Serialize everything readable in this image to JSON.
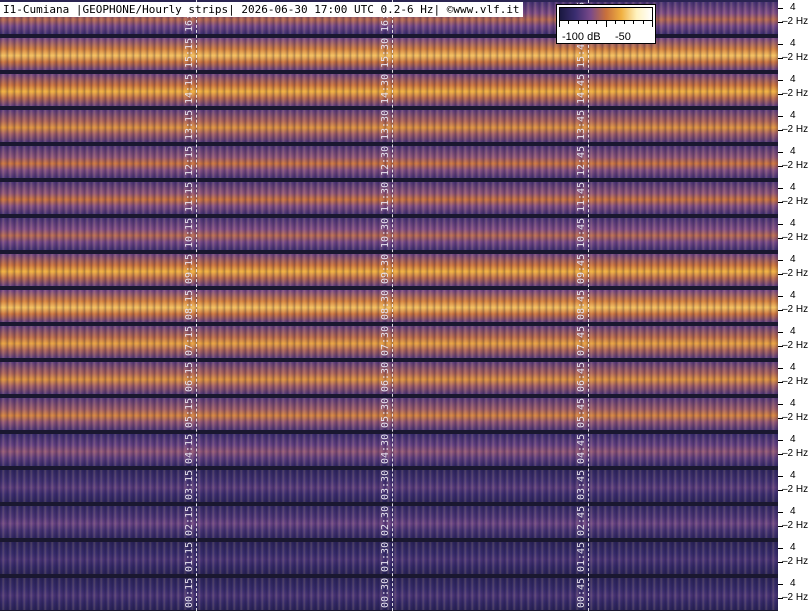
{
  "header": {
    "title": "I1-Cumiana |GEOPHONE/Hourly strips| 2026-06-30 17:00 UTC 0.2-6 Hz| ©www.vlf.it"
  },
  "colorbar": {
    "label_low": "-100 dB",
    "label_high": "-50",
    "colors": [
      "#1a1840",
      "#3a2d70",
      "#7a4a8a",
      "#c8703c",
      "#f0b040",
      "#fff3c0",
      "#ffffff"
    ]
  },
  "frequency_axis": {
    "upper_label": "4",
    "lower_label": "2 Hz"
  },
  "strips": [
    {
      "intensity": 0.55,
      "labels": [
        "16:15",
        "16:30",
        "16:45"
      ]
    },
    {
      "intensity": 0.85,
      "labels": [
        "15:15",
        "15:30",
        "15:45"
      ]
    },
    {
      "intensity": 0.8,
      "labels": [
        "14:15",
        "14:30",
        "14:45"
      ]
    },
    {
      "intensity": 0.7,
      "labels": [
        "13:15",
        "13:30",
        "13:45"
      ]
    },
    {
      "intensity": 0.6,
      "labels": [
        "12:15",
        "12:30",
        "12:45"
      ]
    },
    {
      "intensity": 0.6,
      "labels": [
        "11:15",
        "11:30",
        "11:45"
      ]
    },
    {
      "intensity": 0.55,
      "labels": [
        "10:15",
        "10:30",
        "10:45"
      ]
    },
    {
      "intensity": 0.8,
      "labels": [
        "09:15",
        "09:30",
        "09:45"
      ]
    },
    {
      "intensity": 0.85,
      "labels": [
        "08:15",
        "08:30",
        "08:45"
      ]
    },
    {
      "intensity": 0.75,
      "labels": [
        "07:15",
        "07:30",
        "07:45"
      ]
    },
    {
      "intensity": 0.7,
      "labels": [
        "06:15",
        "06:30",
        "06:45"
      ]
    },
    {
      "intensity": 0.65,
      "labels": [
        "05:15",
        "05:30",
        "05:45"
      ]
    },
    {
      "intensity": 0.45,
      "labels": [
        "04:15",
        "04:30",
        "04:45"
      ]
    },
    {
      "intensity": 0.3,
      "labels": [
        "03:15",
        "03:30",
        "03:45"
      ]
    },
    {
      "intensity": 0.35,
      "labels": [
        "02:15",
        "02:30",
        "02:45"
      ]
    },
    {
      "intensity": 0.25,
      "labels": [
        "01:15",
        "01:30",
        "01:45"
      ]
    },
    {
      "intensity": 0.25,
      "labels": [
        "00:15",
        "00:30",
        "00:45"
      ]
    }
  ]
}
